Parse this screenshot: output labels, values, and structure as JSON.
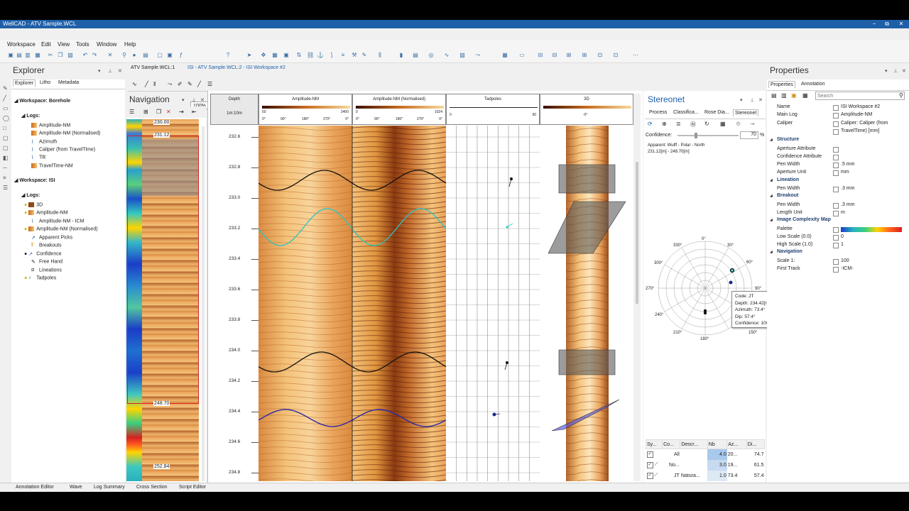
{
  "window": {
    "title": "WellCAD - ATV Sample.WCL",
    "btn_min": "−",
    "btn_max": "⧉",
    "btn_close": "✕"
  },
  "menu": [
    "Workspace",
    "Edit",
    "View",
    "Tools",
    "Window",
    "Help"
  ],
  "toolbar": {
    "zoom": "100%"
  },
  "doc_tabs": {
    "tab1": "ATV Sample.WCL:1",
    "tab2": "ISI - ATV Sample.WCL:2 - ISI Workspace #2"
  },
  "explorer": {
    "title": "Explorer",
    "tabs": [
      "Explorer",
      "Litho",
      "Metadata"
    ],
    "ws1": "Workspace: Borehole",
    "ws1_logs": "Logs:",
    "ws1_items": [
      "Amplitude-NM",
      "Amplitude-NM (Normalised)",
      "Azimuth",
      "Caliper (from TravelTime)",
      "Tilt",
      "TravelTime-NM"
    ],
    "ws2": "Workspace: ISI",
    "ws2_logs": "Logs:",
    "ws2_items": [
      "3D",
      "Amplitude-NM",
      "Amplitude-NM - ICM",
      "Amplitude-NM (Normalised)",
      "Apparent Picks",
      "Breakouts",
      "Confidence",
      "Free Hand",
      "Lineations",
      "Tadpoles"
    ]
  },
  "navigation": {
    "title": "Navigation",
    "depth_top": "230.00",
    "depth_sel_top": "231.12",
    "depth_sel_bottom": "248.70",
    "depth_bottom": "252.84"
  },
  "depth_track": {
    "header": "Depth",
    "unit": "1m:10m",
    "labels": [
      "232.6",
      "232.8",
      "233.0",
      "233.2",
      "233.4",
      "233.6",
      "233.8",
      "234.0",
      "234.2",
      "234.4",
      "234.6",
      "234.8"
    ]
  },
  "tracks": {
    "amp": {
      "title": "Amplitude-NM",
      "min": "50",
      "max": "2400",
      "ticks": [
        "0°",
        "90°",
        "180°",
        "270°",
        "0°"
      ]
    },
    "ampn": {
      "title": "Amplitude-NM (Normalised)",
      "min": "0",
      "max": "1024",
      "ticks": [
        "0°",
        "90°",
        "180°",
        "270°",
        "0°"
      ]
    },
    "tad": {
      "title": "Tadpoles",
      "min": "0",
      "max": "90"
    },
    "d3": {
      "title": "3D",
      "tick": "-0°"
    }
  },
  "stereonet": {
    "title": "Stereonet",
    "tabs": [
      "Process",
      "Classifica...",
      "Rose Dia...",
      "Stereonet"
    ],
    "confidence_label": "Confidence:",
    "confidence_value": "70",
    "confidence_unit": "%",
    "info1": "Apparent: Wulff - Polar - North",
    "info2": "231.12[m] - 248.70[m]",
    "angles": [
      "0°",
      "30°",
      "60°",
      "90°",
      "150°",
      "180°",
      "210°",
      "240°",
      "270°",
      "300°",
      "330°"
    ],
    "tooltip": [
      "Code: JT",
      "Depth: 234.42[m]",
      "Azimuth: 73.4°",
      "Dip: 57.4°",
      "Confidence: 100%"
    ],
    "table_headers": [
      "Sy...",
      "Co...",
      "Descr...",
      "Nb",
      "Az...",
      "Di..."
    ],
    "table_rows": [
      [
        "",
        "All",
        "",
        "4.0",
        "20...",
        "74.7"
      ],
      [
        "",
        "No...",
        "",
        "3.0",
        "19...",
        "61.5"
      ],
      [
        "",
        "JT",
        "Natura...",
        "1.0",
        "73.4",
        "57.4"
      ]
    ]
  },
  "properties": {
    "title": "Properties",
    "tabs": [
      "Properties",
      "Annotation"
    ],
    "search_placeholder": "Search",
    "rows_top": [
      {
        "k": "Name",
        "v": "ISI Workspace #2"
      },
      {
        "k": "Main Log",
        "v": "Amplitude-NM"
      },
      {
        "k": "Caliper",
        "v": "Caliper: Caliper (from"
      },
      {
        "k": "",
        "v": "TravelTime) [mm]"
      }
    ],
    "cat_structure": "Structure",
    "structure": [
      {
        "k": "Aperture Attribute",
        "v": ""
      },
      {
        "k": "Confidence Attribute",
        "v": ""
      },
      {
        "k": "Pen Width",
        "v": ".5 mm"
      },
      {
        "k": "Aperture Unit",
        "v": "mm"
      }
    ],
    "cat_lineation": "Lineation",
    "lineation": [
      {
        "k": "Pen Width",
        "v": ".3 mm"
      }
    ],
    "cat_breakout": "Breakout",
    "breakout": [
      {
        "k": "Pen Width",
        "v": ".3 mm"
      },
      {
        "k": "Length Unit",
        "v": "m"
      }
    ],
    "cat_icm": "Image Complexity Map",
    "icm": [
      {
        "k": "Palette",
        "v": ""
      },
      {
        "k": "Low Scale (0.0)",
        "v": "0"
      },
      {
        "k": "High Scale (1.0)",
        "v": "1"
      }
    ],
    "cat_nav": "Navigation",
    "nav": [
      {
        "k": "Scale 1:",
        "v": "100"
      },
      {
        "k": "First Track",
        "v": "-ICM-"
      }
    ]
  },
  "statusbar": [
    "Annotation Editor",
    "Wave",
    "Log Summary",
    "Cross Section",
    "Script Editor"
  ],
  "colors": {
    "accent": "#1f5fa8",
    "image_dark": "#6b2a0a",
    "image_light": "#f4c27a",
    "cyan_sine": "#29c4c4",
    "blue_sine": "#2a2aa8"
  }
}
